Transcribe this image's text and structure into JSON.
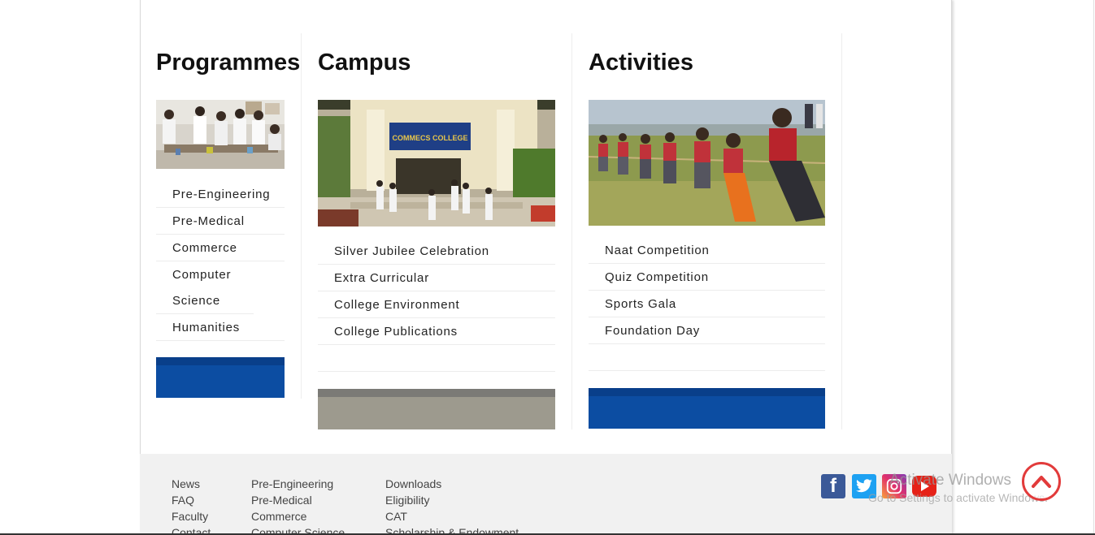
{
  "programmes": {
    "title": "Programmes",
    "image_alt": "Students in laboratory",
    "items": [
      "Pre-Engineering",
      "Pre-Medical",
      "Commerce",
      "Computer Science",
      "Humanities"
    ]
  },
  "campus": {
    "title": "Campus",
    "sign_text": "COMMECS COLLEGE",
    "items": [
      "Silver Jubilee Celebration",
      "Extra Curricular",
      "College Environment",
      "College Publications"
    ]
  },
  "activities": {
    "title": "Activities",
    "items": [
      "Naat Competition",
      "Quiz Competition",
      "Sports Gala",
      "Foundation Day"
    ]
  },
  "footer": {
    "col1": [
      "News",
      "FAQ",
      "Faculty",
      "Contact"
    ],
    "col2": [
      "Pre-Engineering",
      "Pre-Medical",
      "Commerce",
      "Computer Science"
    ],
    "col3": [
      "Downloads",
      "Eligibility",
      "CAT",
      "Scholarship & Endowment"
    ]
  },
  "social": {
    "facebook": "f",
    "twitter": "t",
    "instagram": "instagram-icon",
    "youtube": "youtube-icon"
  },
  "watermark": {
    "line1": "Activate Windows",
    "line2": "Go to Settings to activate Windows."
  },
  "colors": {
    "accent_blue": "#0c4da2",
    "gray_button": "#9d9a8e",
    "scroll_top_red": "#e23b3b",
    "facebook": "#3b5998",
    "twitter": "#1da1f2",
    "youtube": "#e62117"
  }
}
